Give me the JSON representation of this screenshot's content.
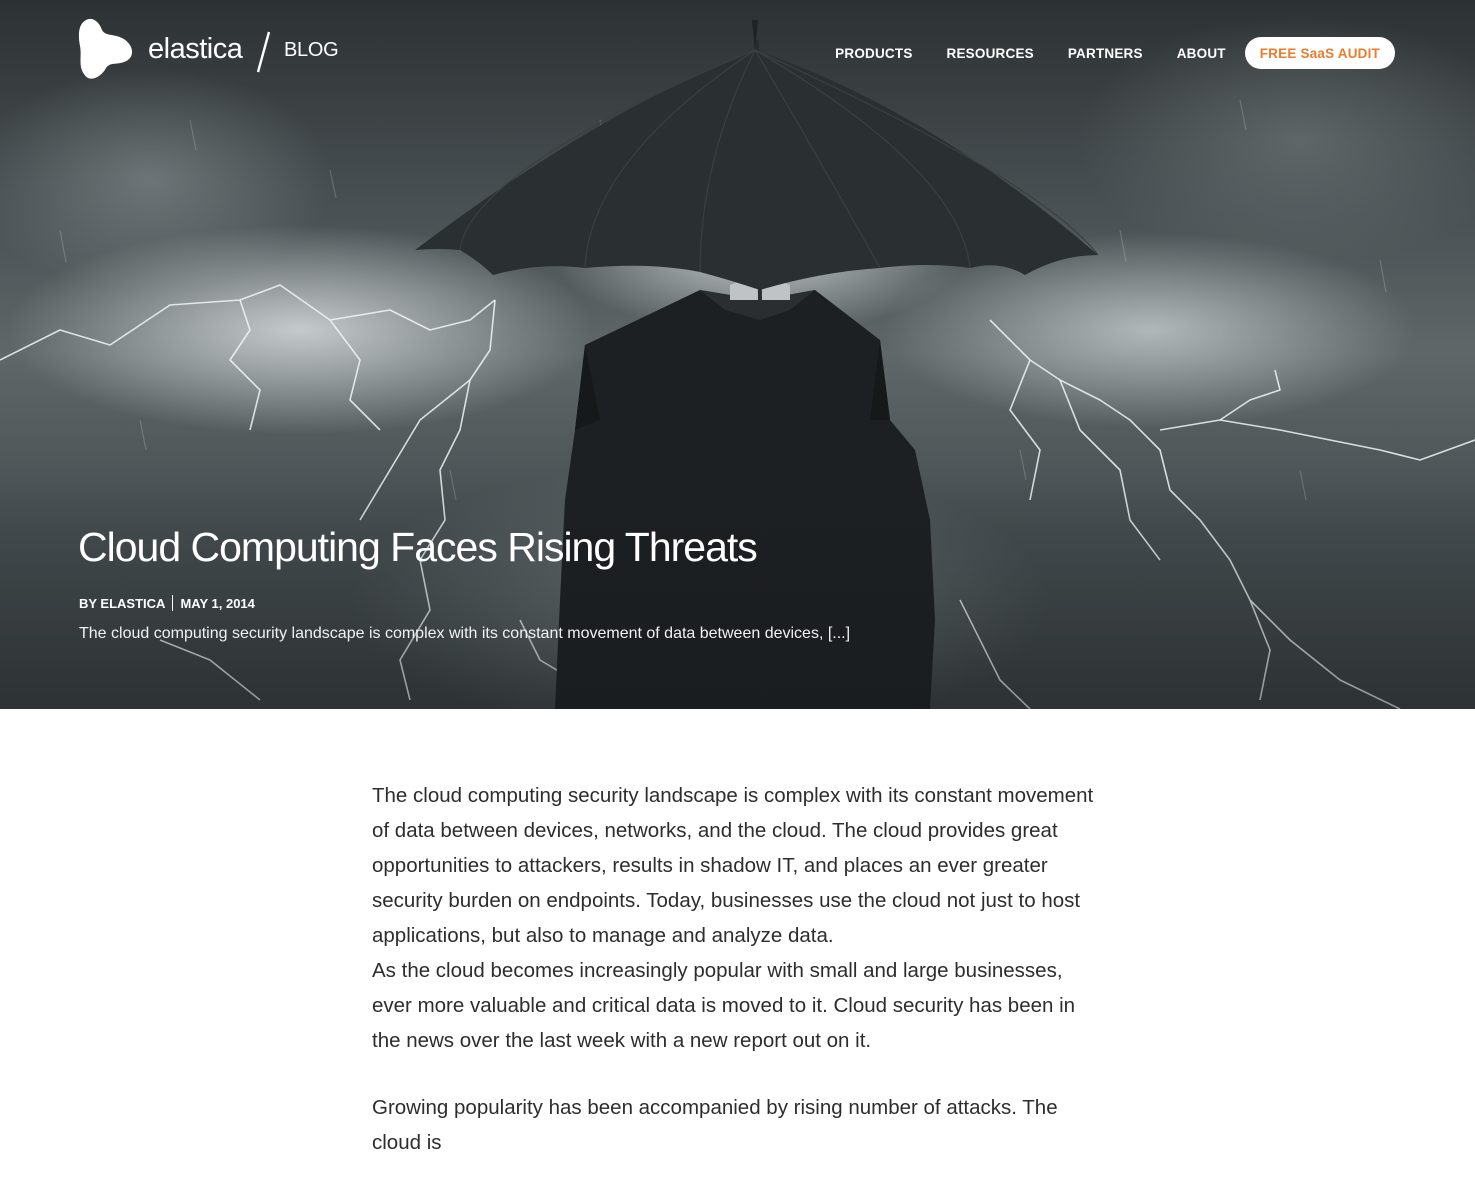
{
  "header": {
    "brand": "elastica",
    "section": "BLOG",
    "nav": [
      {
        "label": "PRODUCTS"
      },
      {
        "label": "RESOURCES"
      },
      {
        "label": "PARTNERS"
      },
      {
        "label": "ABOUT"
      }
    ],
    "cta_label": "FREE SaaS AUDIT",
    "cta_color": "#ef7b2a"
  },
  "hero": {
    "title": "Cloud Computing Faces Rising Threats",
    "author": "BY ELASTICA",
    "date": "MAY 1, 2014",
    "excerpt": "The cloud computing security landscape is complex with its constant movement of data between devices, [...]"
  },
  "article": {
    "paragraphs": [
      "The cloud computing security landscape is complex with its constant movement of data between devices, networks, and the cloud. The cloud provides great opportunities to attackers, results in shadow IT, and places an ever greater security burden on endpoints. Today, businesses use the cloud not just to host applications, but also to manage and analyze data.",
      "As the cloud becomes increasingly popular with small and large businesses, ever more valuable and critical data is moved to it. Cloud security has been in the news over the last week with a new report out on it.",
      "Growing popularity has been accompanied by rising number of attacks. The cloud is"
    ]
  }
}
